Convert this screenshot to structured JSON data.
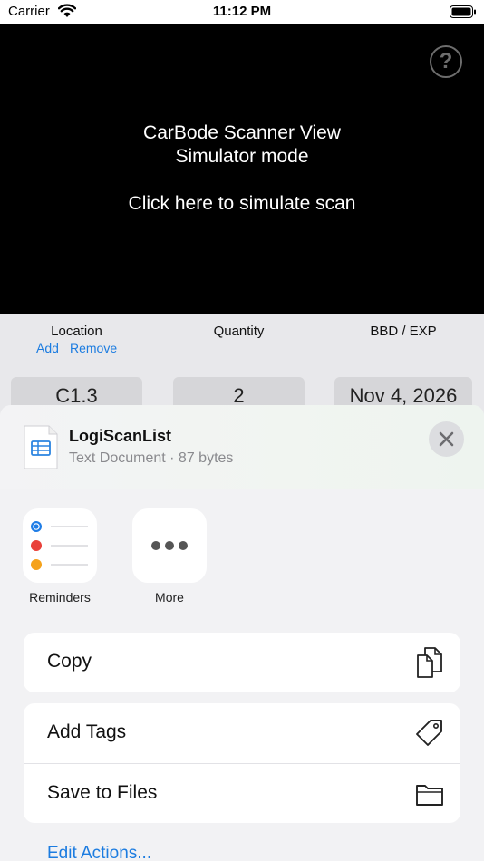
{
  "status_bar": {
    "carrier": "Carrier",
    "time": "11:12 PM"
  },
  "scanner": {
    "line1": "CarBode Scanner View",
    "line2": "Simulator mode",
    "line3": "Click here to simulate scan",
    "help_glyph": "?"
  },
  "fields": {
    "location_label": "Location",
    "add_link": "Add",
    "remove_link": "Remove",
    "location_value": "C1.3",
    "quantity_label": "Quantity",
    "quantity_value": "2",
    "bbd_label": "BBD / EXP",
    "bbd_value": "Nov 4, 2026"
  },
  "share_sheet": {
    "doc_title": "LogiScanList",
    "doc_subtitle": "Text Document · 87 bytes",
    "apps": [
      {
        "label": "Reminders",
        "icon": "reminders-icon"
      },
      {
        "label": "More",
        "icon": "more-icon"
      }
    ],
    "actions": {
      "copy": {
        "label": "Copy",
        "icon": "copy-icon"
      },
      "add_tags": {
        "label": "Add Tags",
        "icon": "tag-icon"
      },
      "save_to_files": {
        "label": "Save to Files",
        "icon": "folder-icon"
      }
    },
    "edit_actions": "Edit Actions..."
  },
  "colors": {
    "accent": "#1c7ce0",
    "scanner_bg": "#000000",
    "sheet_bg": "#f2f2f4"
  }
}
